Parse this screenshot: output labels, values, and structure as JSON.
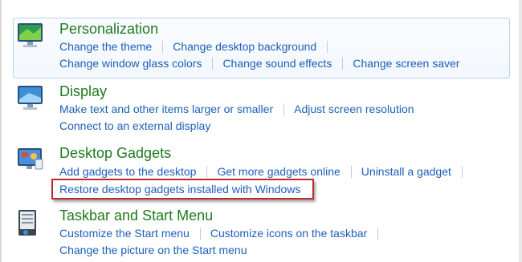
{
  "categories": [
    {
      "title": "Personalization",
      "icon": "personalization-icon",
      "rows": [
        [
          "Change the theme",
          "Change desktop background"
        ],
        [
          "Change window glass colors",
          "Change sound effects",
          "Change screen saver"
        ]
      ]
    },
    {
      "title": "Display",
      "icon": "display-icon",
      "rows": [
        [
          "Make text and other items larger or smaller",
          "Adjust screen resolution"
        ],
        [
          "Connect to an external display"
        ]
      ]
    },
    {
      "title": "Desktop Gadgets",
      "icon": "desktop-gadgets-icon",
      "rows": [
        [
          "Add gadgets to the desktop",
          "Get more gadgets online",
          "Uninstall a gadget"
        ],
        [
          "Restore desktop gadgets installed with Windows"
        ]
      ]
    },
    {
      "title": "Taskbar and Start Menu",
      "icon": "taskbar-start-menu-icon",
      "rows": [
        [
          "Customize the Start menu",
          "Customize icons on the taskbar"
        ],
        [
          "Change the picture on the Start menu"
        ]
      ]
    }
  ],
  "colors": {
    "title_green": "#1e7a1e",
    "link_blue": "#1c5fb8",
    "highlight_border": "#b8d2ee",
    "annotation_red": "#c1272d"
  }
}
